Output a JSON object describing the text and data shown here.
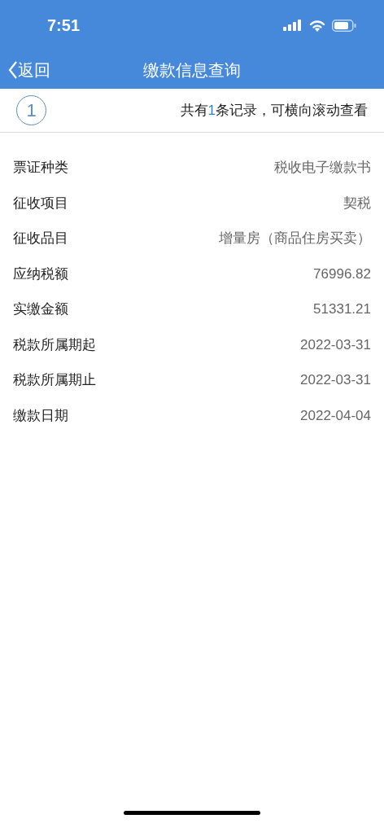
{
  "status_bar": {
    "time": "7:51"
  },
  "nav": {
    "back": "返回",
    "title": "缴款信息查询"
  },
  "record_bar": {
    "index": "1",
    "summary": {
      "before": "共有",
      "count": "1",
      "after": "条记录，可横向滚动查看"
    }
  },
  "fields": [
    {
      "label": "票证种类",
      "value": "税收电子缴款书"
    },
    {
      "label": "征收项目",
      "value": "契税"
    },
    {
      "label": "征收品目",
      "value": "增量房（商品住房买卖）"
    },
    {
      "label": "应纳税额",
      "value": "76996.82"
    },
    {
      "label": "实缴金额",
      "value": "51331.21"
    },
    {
      "label": "税款所属期起",
      "value": "2022-03-31"
    },
    {
      "label": "税款所属期止",
      "value": "2022-03-31"
    },
    {
      "label": "缴款日期",
      "value": "2022-04-04"
    }
  ]
}
